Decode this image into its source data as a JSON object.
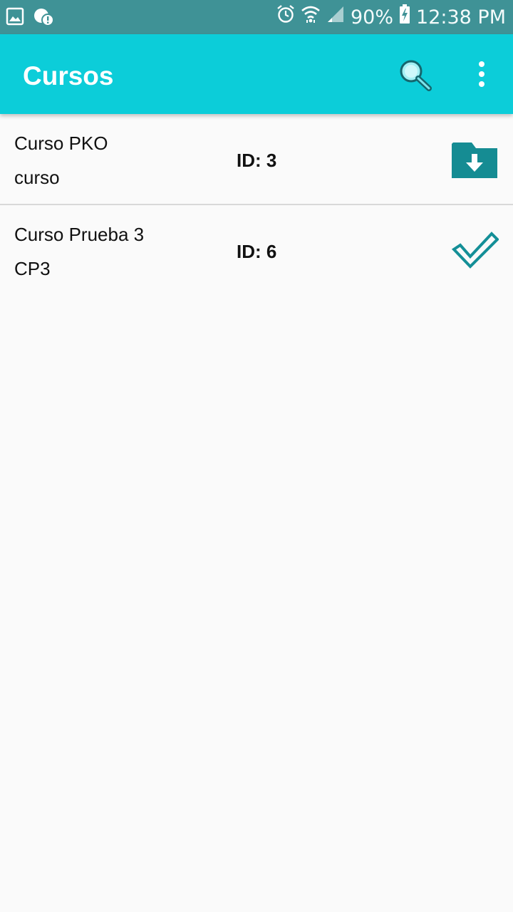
{
  "status_bar": {
    "battery_percent": "90%",
    "time": "12:38 PM",
    "icons": [
      "gallery-icon",
      "chat-alert-icon",
      "alarm-icon",
      "wifi-icon",
      "signal-icon",
      "battery-charging-icon"
    ]
  },
  "app_bar": {
    "title": "Cursos",
    "icons": [
      "search-icon",
      "more-vert-icon"
    ]
  },
  "courses": [
    {
      "name": "Curso PKO",
      "code": "curso",
      "id_label": "ID: 3",
      "action_icon": "download-folder-icon"
    },
    {
      "name": "Curso Prueba 3",
      "code": "CP3",
      "id_label": "ID: 6",
      "action_icon": "check-icon"
    }
  ],
  "colors": {
    "status_bar": "#3f9296",
    "app_bar": "#0ccdd9",
    "accent": "#148f97",
    "background": "#fafafa"
  }
}
